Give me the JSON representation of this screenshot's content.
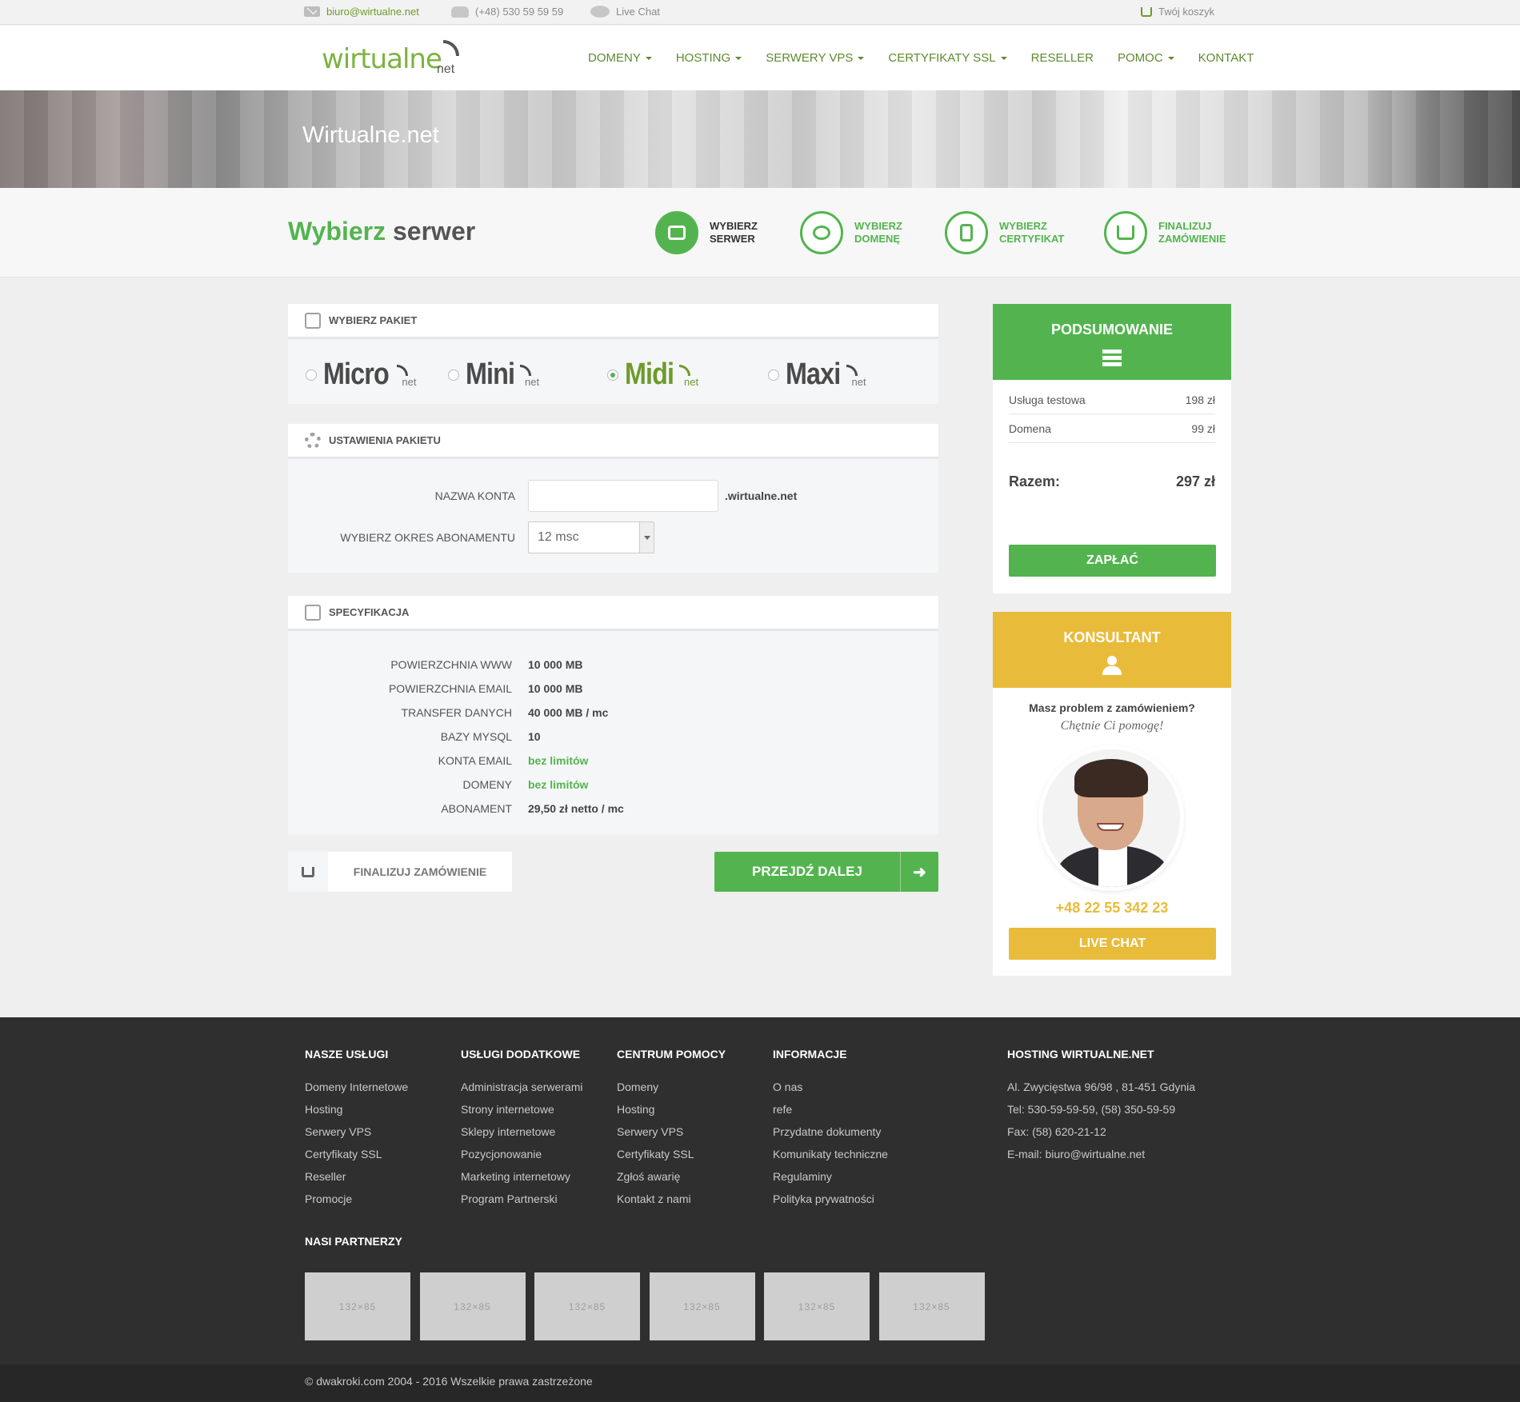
{
  "topbar": {
    "email": "biuro@wirtualne.net",
    "phone": "(+48) 530 59 59 59",
    "chat": "Live Chat",
    "cart": "Twój koszyk"
  },
  "header": {
    "logo_main": "wirtualne",
    "logo_sub": "net",
    "nav": [
      {
        "label": "DOMENY",
        "dropdown": true
      },
      {
        "label": "HOSTING",
        "dropdown": true
      },
      {
        "label": "SERWERY VPS",
        "dropdown": true
      },
      {
        "label": "CERTYFIKATY SSL",
        "dropdown": true
      },
      {
        "label": "RESELLER",
        "dropdown": false
      },
      {
        "label": "POMOC",
        "dropdown": true
      },
      {
        "label": "KONTAKT",
        "dropdown": false
      }
    ]
  },
  "hero": {
    "title": "Wirtualne.net"
  },
  "steps": {
    "heading_green": "Wybierz",
    "heading_rest": "serwer",
    "items": [
      {
        "line1": "WYBIERZ",
        "line2": "SERWER",
        "active": true
      },
      {
        "line1": "WYBIERZ",
        "line2": "DOMENĘ",
        "active": false
      },
      {
        "line1": "WYBIERZ",
        "line2": "CERTYFIKAT",
        "active": false
      },
      {
        "line1": "FINALIZUJ",
        "line2": "ZAMÓWIENIE",
        "active": false
      }
    ]
  },
  "packages": {
    "title": "WYBIERZ PAKIET",
    "items": [
      {
        "name": "Micro",
        "sub": "net",
        "selected": false
      },
      {
        "name": "Mini",
        "sub": "net",
        "selected": false
      },
      {
        "name": "Midi",
        "sub": "net",
        "selected": true
      },
      {
        "name": "Maxi",
        "sub": "net",
        "selected": false
      }
    ]
  },
  "settings": {
    "title": "USTAWIENIA PAKIETU",
    "account_label": "NAZWA KONTA",
    "account_value": "",
    "account_suffix": ".wirtualne.net",
    "period_label": "WYBIERZ OKRES ABONAMENTU",
    "period_value": "12 msc"
  },
  "spec": {
    "title": "SPECYFIKACJA",
    "rows": [
      {
        "k": "POWIERZCHNIA WWW",
        "v": "10 000 MB",
        "green": false
      },
      {
        "k": "POWIERZCHNIA EMAIL",
        "v": "10 000 MB",
        "green": false
      },
      {
        "k": "TRANSFER DANYCH",
        "v": "40 000 MB / mc",
        "green": false
      },
      {
        "k": "BAZY MYSQL",
        "v": "10",
        "green": false
      },
      {
        "k": "KONTA EMAIL",
        "v": "bez limitów",
        "green": true
      },
      {
        "k": "DOMENY",
        "v": "bez limitów",
        "green": true
      },
      {
        "k": "ABONAMENT",
        "v": "29,50 zł netto / mc",
        "green": false
      }
    ]
  },
  "actions": {
    "finalize": "FINALIZUJ ZAMÓWIENIE",
    "next": "PRZEJDŹ DALEJ"
  },
  "summary": {
    "title": "PODSUMOWANIE",
    "rows": [
      {
        "name": "Usługa testowa",
        "price": "198 zł"
      },
      {
        "name": "Domena",
        "price": "99 zł"
      }
    ],
    "total_label": "Razem:",
    "total_value": "297 zł",
    "pay": "ZAPŁAĆ",
    "color": "#53b44f"
  },
  "consultant": {
    "title": "KONSULTANT",
    "question": "Masz problem z zamówieniem?",
    "help": "Chętnie Ci pomogę!",
    "phone": "+48 22 55 342 23",
    "chat": "LIVE CHAT",
    "color": "#e9bb3a"
  },
  "footer": {
    "cols": [
      {
        "title": "NASZE USŁUGI",
        "links": [
          "Domeny Internetowe",
          "Hosting",
          "Serwery VPS",
          "Certyfikaty SSL",
          "Reseller",
          "Promocje"
        ]
      },
      {
        "title": "USŁUGI DODATKOWE",
        "links": [
          "Administracja serwerami",
          "Strony internetowe",
          "Sklepy internetowe",
          "Pozycjonowanie",
          "Marketing internetowy",
          "Program Partnerski"
        ]
      },
      {
        "title": "CENTRUM POMOCY",
        "links": [
          "Domeny",
          "Hosting",
          "Serwery VPS",
          "Certyfikaty SSL",
          "Zgłoś awarię",
          "Kontakt z nami"
        ]
      },
      {
        "title": "INFORMACJE",
        "links": [
          "O nas",
          "refe",
          "Przydatne dokumenty",
          "Komunikaty techniczne",
          "Regulaminy",
          "Polityka prywatności"
        ]
      },
      {
        "title": "HOSTING WIRTUALNE.NET",
        "links": [
          "Al. Zwycięstwa 96/98 , 81-451 Gdynia",
          "Tel: 530-59-59-59, (58) 350-59-59",
          "Fax: (58) 620-21-12",
          "E-mail: biuro@wirtualne.net"
        ]
      }
    ],
    "partners_title": "NASI PARTNERZY",
    "partners": [
      "132×85",
      "132×85",
      "132×85",
      "132×85",
      "132×85",
      "132×85"
    ],
    "copyright": "© dwakroki.com 2004 - 2016 Wszelkie prawa zastrzeżone"
  }
}
